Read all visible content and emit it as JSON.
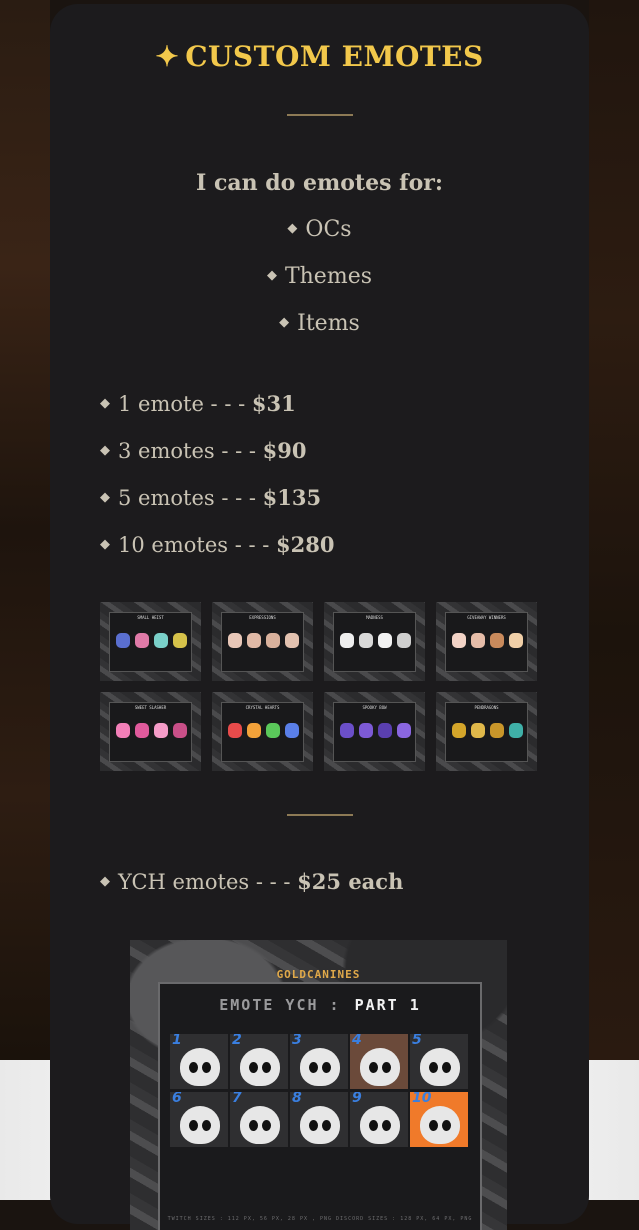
{
  "title": {
    "star": "✦",
    "text": "CUSTOM EMOTES"
  },
  "intro": "I can do emotes for:",
  "options": [
    "OCs",
    "Themes",
    "Items"
  ],
  "diamond_glyph": "◆",
  "prices": [
    {
      "label": "1 emote - - - ",
      "price": "$31"
    },
    {
      "label": "3 emotes - - - ",
      "price": "$90"
    },
    {
      "label": "5 emotes - - - ",
      "price": "$135"
    },
    {
      "label": "10 emotes - - - ",
      "price": "$280"
    }
  ],
  "thumbnails": [
    {
      "label": "SMALL HEIST",
      "colors": [
        "#5a6fd0",
        "#e07aa8",
        "#7ad0c9",
        "#d6c24a"
      ]
    },
    {
      "label": "EXPRESSIONS",
      "colors": [
        "#e8c7b8",
        "#e0b9a6",
        "#d9b19c",
        "#e3c2b0"
      ]
    },
    {
      "label": "MADNESS",
      "colors": [
        "#eeeeee",
        "#d9d9d9",
        "#f2f2f2",
        "#cfcfcf"
      ]
    },
    {
      "label": "GIVEAWAY WINNERS",
      "colors": [
        "#f2d3c6",
        "#e6bda9",
        "#c98a5c",
        "#f0cfa8"
      ]
    },
    {
      "label": "SWEET SLASHER",
      "colors": [
        "#f27fb8",
        "#e05a9c",
        "#f59cc8",
        "#c94f88"
      ]
    },
    {
      "label": "CRYSTAL HEARTS",
      "colors": [
        "#e84b4b",
        "#f2a23a",
        "#5ac85a",
        "#5a7fe8"
      ]
    },
    {
      "label": "SPOOKY BOW",
      "colors": [
        "#6b4fc9",
        "#7d5ad6",
        "#5a3fb0",
        "#8a66e0"
      ]
    },
    {
      "label": "PENDRAGONS",
      "colors": [
        "#d4a52a",
        "#e0b84a",
        "#c9962a",
        "#3fb0a8"
      ]
    }
  ],
  "ych_line": {
    "label": "YCH emotes - - - ",
    "price": "$25 each"
  },
  "ych_image": {
    "brand": "GOLDCANINES",
    "heading": "EMOTE YCH :",
    "part": "PART 1",
    "numbers": [
      "1",
      "2",
      "3",
      "4",
      "5",
      "6",
      "7",
      "8",
      "9",
      "10"
    ],
    "sizes": "TWITCH SIZES : 112 PX, 56 PX, 28 PX , PNG    DISCORD SIZES : 128 PX, 64 PX, PNG"
  },
  "colors": {
    "accent": "#f2c84b",
    "text": "#c9c3b4",
    "card": "#1c1b1d"
  }
}
